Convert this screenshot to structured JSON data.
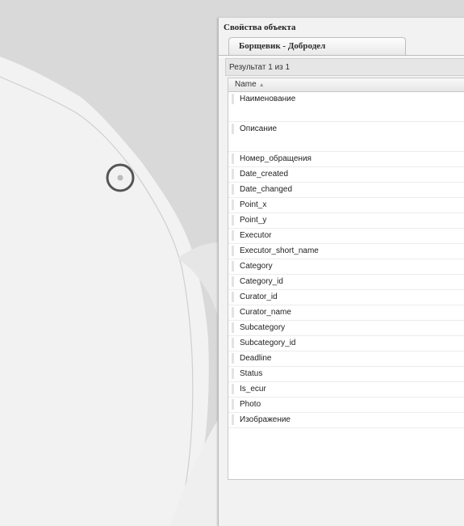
{
  "panel": {
    "title": "Свойства объекта",
    "tab_label": "Борщевик - Добродел",
    "result_text": "Результат 1 из 1",
    "column_header": "Name",
    "sort_icon": "sort-ascending-icon",
    "fields": [
      {
        "label": "Наименование",
        "tall": true
      },
      {
        "label": "Описание",
        "tall": true
      },
      {
        "label": "Номер_обращения",
        "tall": false
      },
      {
        "label": "Date_created",
        "tall": false
      },
      {
        "label": "Date_changed",
        "tall": false
      },
      {
        "label": "Point_x",
        "tall": false
      },
      {
        "label": "Point_y",
        "tall": false
      },
      {
        "label": "Executor",
        "tall": false
      },
      {
        "label": "Executor_short_name",
        "tall": false
      },
      {
        "label": "Category",
        "tall": false
      },
      {
        "label": "Category_id",
        "tall": false
      },
      {
        "label": "Curator_id",
        "tall": false
      },
      {
        "label": "Curator_name",
        "tall": false
      },
      {
        "label": "Subcategory",
        "tall": false
      },
      {
        "label": "Subcategory_id",
        "tall": false
      },
      {
        "label": "Deadline",
        "tall": false
      },
      {
        "label": "Status",
        "tall": false
      },
      {
        "label": "Is_ecur",
        "tall": false
      },
      {
        "label": "Photo",
        "tall": false
      },
      {
        "label": "Изображение",
        "tall": false
      }
    ]
  },
  "map": {
    "land_color": "#f1f1f1",
    "water_color": "#d9d9d9",
    "marker_ring_color": "#555555",
    "marker_dot_color": "#bbbbbb"
  }
}
